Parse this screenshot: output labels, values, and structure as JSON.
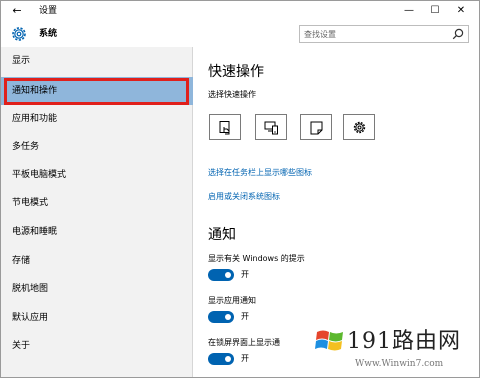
{
  "window": {
    "title": "设置",
    "controls": {
      "minimize": "—",
      "maximize": "☐",
      "close": "✕"
    },
    "back": "←"
  },
  "header": {
    "section_title": "系统",
    "search_placeholder": "查找设置"
  },
  "sidebar": {
    "items": [
      {
        "label": "显示"
      },
      {
        "label": "通知和操作",
        "selected": true
      },
      {
        "label": "应用和功能"
      },
      {
        "label": "多任务"
      },
      {
        "label": "平板电脑模式"
      },
      {
        "label": "节电模式"
      },
      {
        "label": "电源和睡眠"
      },
      {
        "label": "存储"
      },
      {
        "label": "脱机地图"
      },
      {
        "label": "默认应用"
      },
      {
        "label": "关于"
      }
    ]
  },
  "content": {
    "quick_actions_heading": "快速操作",
    "choose_quick_actions": "选择快速操作",
    "quick_action_tiles": [
      {
        "icon": "tablet-mode-icon"
      },
      {
        "icon": "connect-icon"
      },
      {
        "icon": "note-icon"
      },
      {
        "icon": "settings-icon"
      }
    ],
    "link_taskbar_icons": "选择在任务栏上显示哪些图标",
    "link_system_icons": "启用或关闭系统图标",
    "notifications_heading": "通知",
    "toggles": [
      {
        "label": "显示有关 Windows 的提示",
        "state": "开",
        "on": true
      },
      {
        "label": "显示应用通知",
        "state": "开",
        "on": true
      },
      {
        "label": "在锁屏界面上显示通",
        "state": "开",
        "on": true
      }
    ]
  },
  "watermark": {
    "brand": "191路由网",
    "url": "Www.Winwin7.com"
  },
  "colors": {
    "accent": "#0063b1",
    "selected_bg": "#8fb6db",
    "highlight_border": "#e0201b"
  }
}
